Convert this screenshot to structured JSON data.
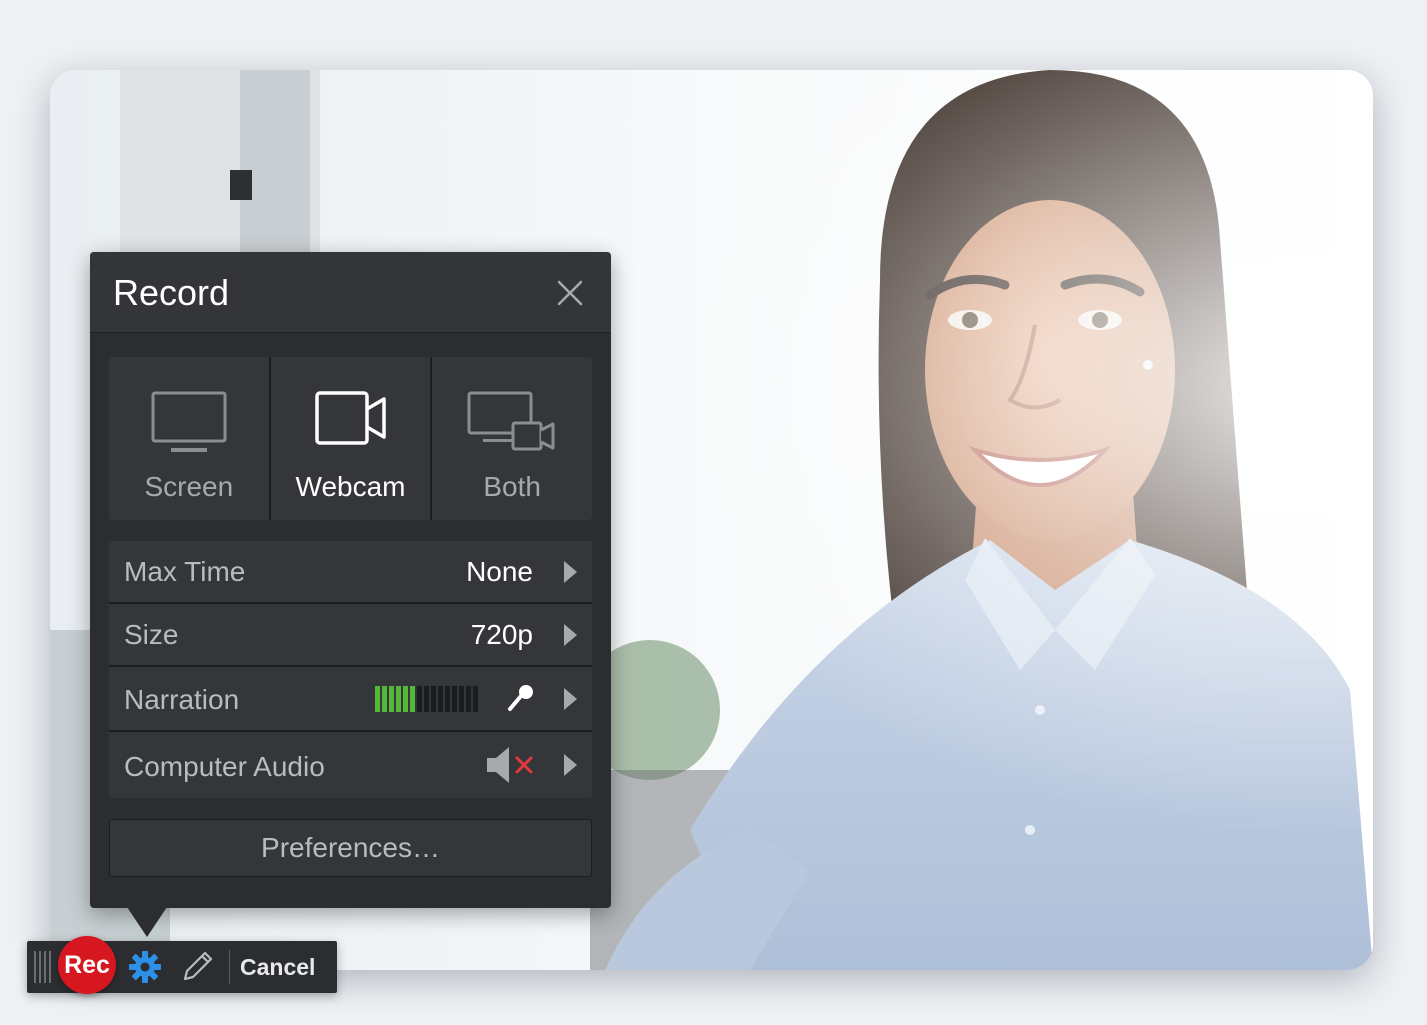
{
  "panel": {
    "title": "Record",
    "modes": [
      {
        "label": "Screen",
        "icon": "monitor-icon",
        "active": false
      },
      {
        "label": "Webcam",
        "icon": "video-camera-icon",
        "active": true
      },
      {
        "label": "Both",
        "icon": "monitor-camera-icon",
        "active": false
      }
    ],
    "settings": {
      "max_time": {
        "label": "Max Time",
        "value": "None"
      },
      "size": {
        "label": "Size",
        "value": "720p"
      },
      "narration": {
        "label": "Narration",
        "level_segments_on": 6,
        "level_segments_total": 15,
        "icon": "microphone-icon"
      },
      "computer_audio": {
        "label": "Computer Audio",
        "icon": "speaker-muted-icon"
      }
    },
    "preferences_label": "Preferences…"
  },
  "toolbar": {
    "rec_label": "Rec",
    "cancel_label": "Cancel"
  },
  "colors": {
    "panel_bg": "#2b2d30",
    "rec_red": "#d7171f",
    "gear_blue": "#2e8fe8",
    "meter_green": "#55b73a",
    "mute_red": "#e0393e"
  }
}
